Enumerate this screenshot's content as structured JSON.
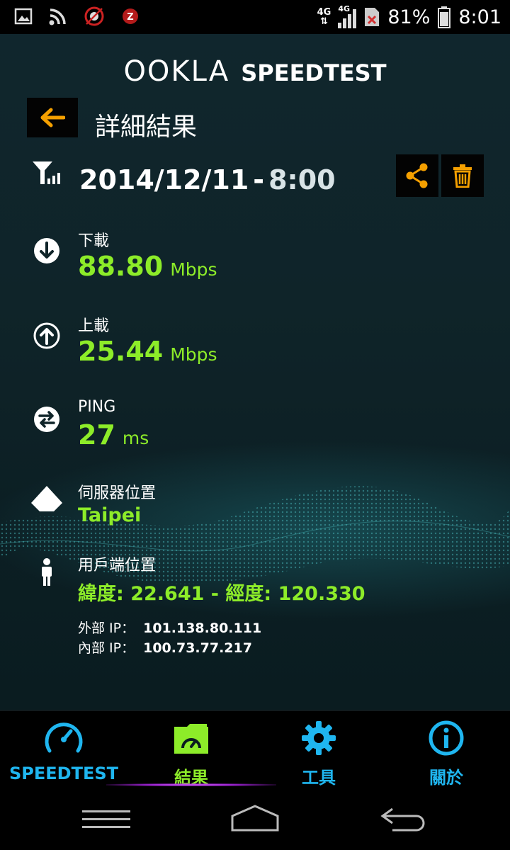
{
  "status_bar": {
    "network_left": "4G",
    "network_right": "4G",
    "battery": "81%",
    "time": "8:01"
  },
  "header": {
    "logo_ookla": "OOKLA",
    "logo_speedtest": "SPEEDTEST"
  },
  "page": {
    "title": "詳細結果"
  },
  "result": {
    "date": "2014/12/11",
    "separator": "-",
    "time": "8:00",
    "download": {
      "label": "下載",
      "value": "88.80",
      "unit": "Mbps"
    },
    "upload": {
      "label": "上載",
      "value": "25.44",
      "unit": "Mbps"
    },
    "ping": {
      "label": "PING",
      "value": "27",
      "unit": "ms"
    },
    "server": {
      "label": "伺服器位置",
      "value": "Taipei"
    },
    "client": {
      "label": "用戶端位置",
      "coords": "緯度: 22.641 - 經度: 120.330",
      "external_ip_label": "外部 IP：",
      "external_ip": "101.138.80.111",
      "internal_ip_label": "內部 IP：",
      "internal_ip": "100.73.77.217"
    }
  },
  "tabs": [
    {
      "label": "SPEEDTEST",
      "icon": "speedometer-icon"
    },
    {
      "label": "結果",
      "icon": "results-folder-icon"
    },
    {
      "label": "工具",
      "icon": "gear-icon"
    },
    {
      "label": "關於",
      "icon": "info-icon"
    }
  ],
  "colors": {
    "accent_green": "#8dec29",
    "accent_orange": "#f5a000",
    "tab_blue": "#1fb6f0"
  }
}
